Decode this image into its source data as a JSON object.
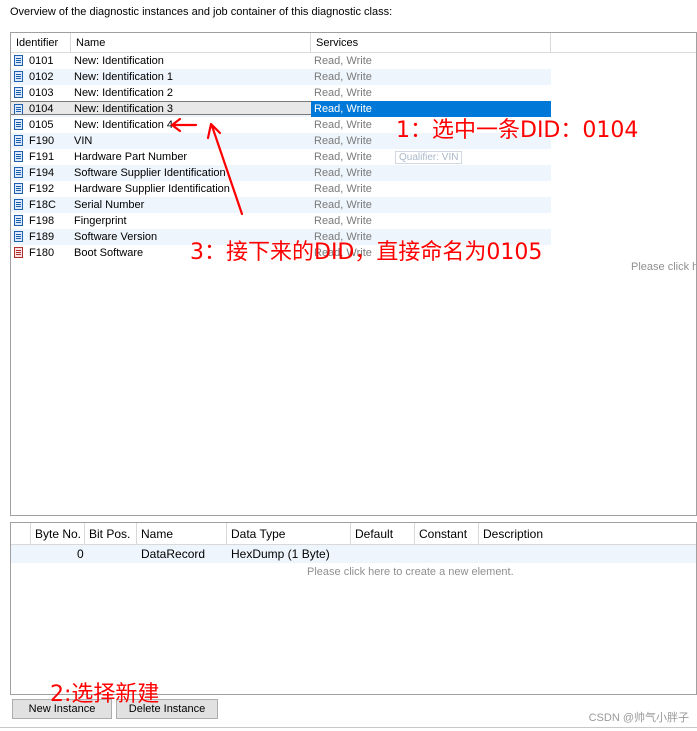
{
  "header": {
    "text": "Overview of the diagnostic instances and job container of this diagnostic class:"
  },
  "instances_table": {
    "columns": [
      "Identifier",
      "Name",
      "Services"
    ],
    "rows": [
      {
        "id": "0101",
        "name": "New: Identification",
        "services": "Read, Write",
        "icon": "document-icon"
      },
      {
        "id": "0102",
        "name": "New: Identification 1",
        "services": "Read, Write",
        "icon": "document-icon"
      },
      {
        "id": "0103",
        "name": "New: Identification 2",
        "services": "Read, Write",
        "icon": "document-icon"
      },
      {
        "id": "0104",
        "name": "New: Identification 3",
        "services": "Read, Write",
        "icon": "document-icon",
        "selected": true
      },
      {
        "id": "0105",
        "name": "New: Identification 4",
        "services": "Read, Write",
        "icon": "document-icon"
      },
      {
        "id": "F190",
        "name": "VIN",
        "services": "Read, Write",
        "icon": "document-icon"
      },
      {
        "id": "F191",
        "name": "Hardware Part Number",
        "services": "Read, Write",
        "icon": "document-icon"
      },
      {
        "id": "F194",
        "name": "Software Supplier Identification",
        "services": "Read, Write",
        "icon": "document-icon"
      },
      {
        "id": "F192",
        "name": "Hardware Supplier Identification",
        "services": "Read, Write",
        "icon": "document-icon"
      },
      {
        "id": "F18C",
        "name": "Serial Number",
        "services": "Read, Write",
        "icon": "document-icon"
      },
      {
        "id": "F198",
        "name": "Fingerprint",
        "services": "Read, Write",
        "icon": "document-icon"
      },
      {
        "id": "F189",
        "name": "Software Version",
        "services": "Read, Write",
        "icon": "document-icon"
      },
      {
        "id": "F180",
        "name": "Boot Software",
        "services": "Read, Write",
        "icon": "document-error-icon"
      }
    ],
    "tooltip": "Qualifier: VIN",
    "hint_right": "Please click h"
  },
  "elements_table": {
    "columns": [
      "Byte No.",
      "Bit Pos.",
      "Name",
      "Data Type",
      "Default",
      "Constant",
      "Description"
    ],
    "rows": [
      {
        "byte_no": "0",
        "bit_pos": "",
        "name": "DataRecord",
        "data_type": "HexDump (1 Byte)",
        "default": "",
        "constant": "",
        "description": ""
      }
    ],
    "hint": "Please click here to create a new element."
  },
  "buttons": {
    "new_instance": "New Instance",
    "delete_instance": "Delete Instance"
  },
  "annotations": {
    "step1": "1：选中一条DID：0104",
    "step2": "2:选择新建",
    "step3": "3：接下来的DID，直接命名为0105"
  },
  "watermark": "CSDN @帅气小胖子",
  "colors": {
    "selection": "#0078d7",
    "annotation": "#ff0000",
    "alt_row": "#eef5fc"
  }
}
